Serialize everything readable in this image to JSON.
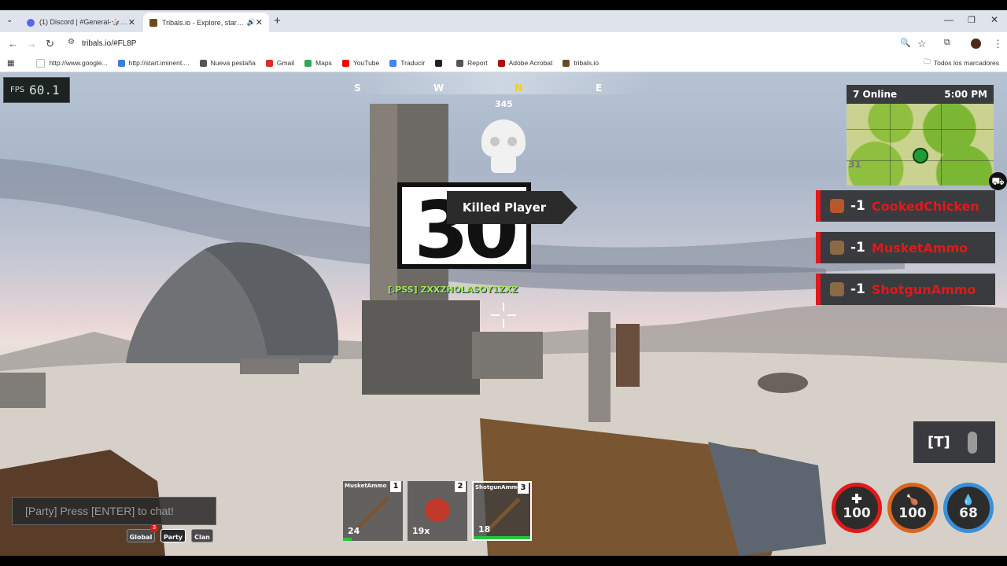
{
  "browser": {
    "tabs": [
      {
        "title": "(1) Discord | #General-🎲 | [P"
      },
      {
        "title": "Tribals.io - Explore, start cla"
      }
    ],
    "new_tab": "+",
    "url": "tribals.io/#FL8P",
    "bookmarks": [
      {
        "label": "http://www.google...",
        "color": "#ffffff"
      },
      {
        "label": "http://start.iminent....",
        "color": "#3b7dd8"
      },
      {
        "label": "Nueva pestaña",
        "color": "#555555"
      },
      {
        "label": "Gmail",
        "color": "#d93025"
      },
      {
        "label": "Maps",
        "color": "#34a853"
      },
      {
        "label": "YouTube",
        "color": "#ff0000"
      },
      {
        "label": "Traducir",
        "color": "#4285f4"
      },
      {
        "label": "",
        "color": "#222222"
      },
      {
        "label": "Report",
        "color": "#555555"
      },
      {
        "label": "Adobe Acrobat",
        "color": "#b30b00"
      },
      {
        "label": "tribals.io",
        "color": "#6b4a1e"
      }
    ],
    "all_bookmarks": "Todos los marcadores"
  },
  "hud": {
    "fps_label": "FPS",
    "fps_value": "60.1",
    "compass": {
      "s": "S",
      "w": "W",
      "n": "N",
      "e": "E",
      "heading": "345"
    },
    "kill_count": "30",
    "kill_message": "Killed Player",
    "player_tag": "[.PSS] ZXXZHOLASOY1ZXZ",
    "online": "7 Online",
    "time": "5:00 PM",
    "minimap_label": "31",
    "pickups": [
      {
        "amount": "-1",
        "item": "CookedChicken"
      },
      {
        "amount": "-1",
        "item": "MusketAmmo"
      },
      {
        "amount": "-1",
        "item": "ShotgunAmmo"
      }
    ],
    "voice_key": "[T]",
    "stats": {
      "health": "100",
      "hunger": "100",
      "thirst": "68"
    },
    "chat_placeholder": "[Party] Press [ENTER] to chat!",
    "chat_tabs": [
      {
        "label": "Global",
        "badge": "3"
      },
      {
        "label": "Party",
        "badge": ""
      },
      {
        "label": "Clan",
        "badge": ""
      }
    ],
    "hotbar": [
      {
        "name": "MusketAmmo",
        "slot": "1",
        "count": "24",
        "progress": 0.15
      },
      {
        "name": "",
        "slot": "2",
        "count": "19x",
        "progress": 0
      },
      {
        "name": "ShotgunAmmo",
        "slot": "3",
        "count": "18",
        "progress": 1.0
      }
    ],
    "colors": {
      "accent_red": "#e01919",
      "health_ring": "#e01919",
      "hunger_ring": "#d9661e",
      "thirst_ring": "#3a8fd8",
      "green": "#22c53b"
    }
  }
}
